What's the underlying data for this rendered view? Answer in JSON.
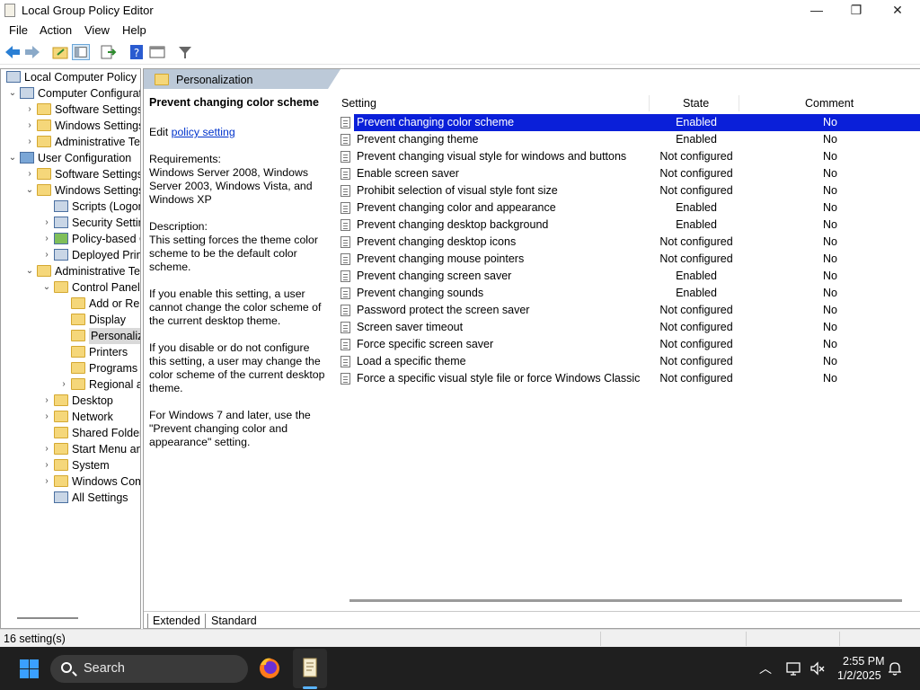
{
  "window": {
    "title": "Local Group Policy Editor",
    "minimize": "—",
    "maximize": "❐",
    "close": "✕"
  },
  "menu": [
    "File",
    "Action",
    "View",
    "Help"
  ],
  "tree": [
    {
      "label": "Local Computer Policy",
      "arrow": "",
      "icon": "computer-policy"
    },
    {
      "label": "Computer Configuration",
      "arrow": "⌄",
      "icon": "computer"
    },
    {
      "label": "Software Settings",
      "arrow": "›",
      "icon": "folder"
    },
    {
      "label": "Windows Settings",
      "arrow": "›",
      "icon": "folder"
    },
    {
      "label": "Administrative Templates",
      "arrow": "›",
      "icon": "folder"
    },
    {
      "label": "User Configuration",
      "arrow": "⌄",
      "icon": "user"
    },
    {
      "label": "Software Settings",
      "arrow": "›",
      "icon": "folder"
    },
    {
      "label": "Windows Settings",
      "arrow": "⌄",
      "icon": "folder"
    },
    {
      "label": "Scripts (Logon/Logoff)",
      "arrow": "",
      "icon": "scripts"
    },
    {
      "label": "Security Settings",
      "arrow": "›",
      "icon": "security"
    },
    {
      "label": "Policy-based QoS",
      "arrow": "›",
      "icon": "chart"
    },
    {
      "label": "Deployed Printers",
      "arrow": "›",
      "icon": "printer"
    },
    {
      "label": "Administrative Templates",
      "arrow": "⌄",
      "icon": "folder"
    },
    {
      "label": "Control Panel",
      "arrow": "⌄",
      "icon": "folder-open"
    },
    {
      "label": "Add or Remove Programs",
      "arrow": "",
      "icon": "folder"
    },
    {
      "label": "Display",
      "arrow": "",
      "icon": "folder"
    },
    {
      "label": "Personalization",
      "arrow": "",
      "icon": "folder-open",
      "selected": true
    },
    {
      "label": "Printers",
      "arrow": "",
      "icon": "folder"
    },
    {
      "label": "Programs",
      "arrow": "",
      "icon": "folder"
    },
    {
      "label": "Regional and Language Options",
      "arrow": "›",
      "icon": "folder"
    },
    {
      "label": "Desktop",
      "arrow": "›",
      "icon": "folder"
    },
    {
      "label": "Network",
      "arrow": "›",
      "icon": "folder"
    },
    {
      "label": "Shared Folders",
      "arrow": "",
      "icon": "folder"
    },
    {
      "label": "Start Menu and Taskbar",
      "arrow": "›",
      "icon": "folder"
    },
    {
      "label": "System",
      "arrow": "›",
      "icon": "folder"
    },
    {
      "label": "Windows Components",
      "arrow": "›",
      "icon": "folder"
    },
    {
      "label": "All Settings",
      "arrow": "",
      "icon": "all-settings"
    }
  ],
  "breadcrumb": "Personalization",
  "description": {
    "title": "Prevent changing color scheme",
    "edit_prefix": "Edit ",
    "edit_link": "policy setting ",
    "requirements_label": "Requirements:",
    "requirements": "Windows Server 2008, Windows Server 2003, Windows Vista, and Windows XP",
    "description_label": "Description:",
    "p1": "This setting forces the theme color scheme to be the default color scheme.",
    "p2": "If you enable this setting, a user cannot change the color scheme of the current desktop theme.",
    "p3": "If you disable or do not configure this setting, a user may change the color scheme of the current desktop theme.",
    "p4": "For Windows 7 and later, use the \"Prevent changing color and appearance\" setting."
  },
  "columns": {
    "setting": "Setting",
    "state": "State",
    "comment": "Comment"
  },
  "settings": [
    {
      "name": "Prevent changing color scheme",
      "state": "Enabled",
      "comment": "No",
      "selected": true
    },
    {
      "name": "Prevent changing theme",
      "state": "Enabled",
      "comment": "No"
    },
    {
      "name": "Prevent changing visual style for windows and buttons",
      "state": "Not configured",
      "comment": "No"
    },
    {
      "name": "Enable screen saver",
      "state": "Not configured",
      "comment": "No"
    },
    {
      "name": "Prohibit selection of visual style font size",
      "state": "Not configured",
      "comment": "No"
    },
    {
      "name": "Prevent changing color and appearance",
      "state": "Enabled",
      "comment": "No"
    },
    {
      "name": "Prevent changing desktop background",
      "state": "Enabled",
      "comment": "No"
    },
    {
      "name": "Prevent changing desktop icons",
      "state": "Not configured",
      "comment": "No"
    },
    {
      "name": "Prevent changing mouse pointers",
      "state": "Not configured",
      "comment": "No"
    },
    {
      "name": "Prevent changing screen saver",
      "state": "Enabled",
      "comment": "No"
    },
    {
      "name": "Prevent changing sounds",
      "state": "Enabled",
      "comment": "No"
    },
    {
      "name": "Password protect the screen saver",
      "state": "Not configured",
      "comment": "No"
    },
    {
      "name": "Screen saver timeout",
      "state": "Not configured",
      "comment": "No"
    },
    {
      "name": "Force specific screen saver",
      "state": "Not configured",
      "comment": "No"
    },
    {
      "name": "Load a specific theme",
      "state": "Not configured",
      "comment": "No"
    },
    {
      "name": "Force a specific visual style file or force Windows Classic",
      "state": "Not configured",
      "comment": "No"
    }
  ],
  "tabs": [
    "Extended",
    "Standard"
  ],
  "status": "16 setting(s)",
  "taskbar": {
    "search_placeholder": "Search",
    "time": "2:55 PM",
    "date": "1/2/2025"
  },
  "colors": {
    "selection": "#0a1fd9",
    "breadcrumb_bar": "#bcc9d8",
    "taskbar": "#1f1f1f",
    "windows_accent": "#3aa0ff"
  }
}
